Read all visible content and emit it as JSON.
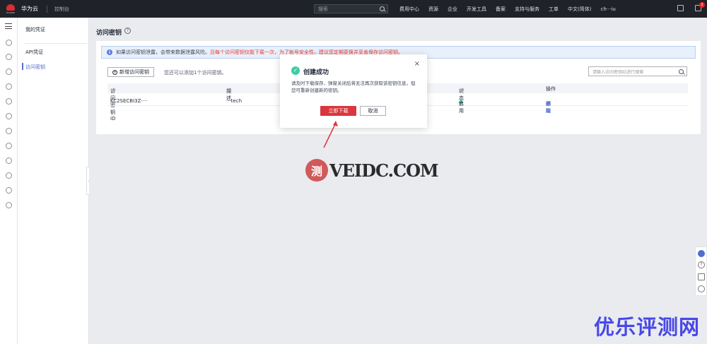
{
  "topbar": {
    "logo_text": "HUAWEI",
    "brand": "华为云",
    "console": "控制台",
    "search_placeholder": "搜索",
    "nav": [
      "费用中心",
      "资源",
      "企业",
      "开发工具",
      "备案",
      "支持与服务",
      "工单",
      "中文(简体)",
      "ch···iu"
    ],
    "notification_count": "2"
  },
  "menu": {
    "my_credentials": "我的凭证",
    "api_credentials": "API凭证",
    "access_keys": "访问密钥"
  },
  "page": {
    "title": "访问密钥",
    "help": "?",
    "info_icon": "i",
    "info_text": "如果访问密钥泄露，会带来数据泄露风险。",
    "info_warn": "且每个访问密钥仅能下载一次，为了帐号安全性，建议您定期更换并妥善保存访问密钥。",
    "new_button": "新增访问密钥",
    "hint": "您还可以添加1个访问密钥。",
    "search_placeholder": "请输入访问密钥ID进行搜索",
    "table": {
      "headers": [
        "访问密钥ID",
        "描述",
        "状态",
        "操作"
      ],
      "sort_icon": "⇅",
      "row": {
        "id": "KC2SECBI3Z····",
        "desc": "···tech",
        "status": "启用",
        "actions": [
          "编辑",
          "停用",
          "删除"
        ]
      }
    }
  },
  "dialog": {
    "title": "创建成功",
    "message": "请及时下载保存，弹窗关闭后将无法再次获取该密钥信息，但您可重新创建新的密钥。",
    "primary_button": "立即下载",
    "cancel_button": "取消",
    "close": "×"
  },
  "watermark": {
    "logo_char": "测",
    "site": "VEIDC.COM",
    "brand2": "优乐评测网"
  },
  "colors": {
    "accent": "#526ecc",
    "danger": "#d9363e",
    "success": "#3dcca6",
    "topbar": "#1f2329"
  }
}
